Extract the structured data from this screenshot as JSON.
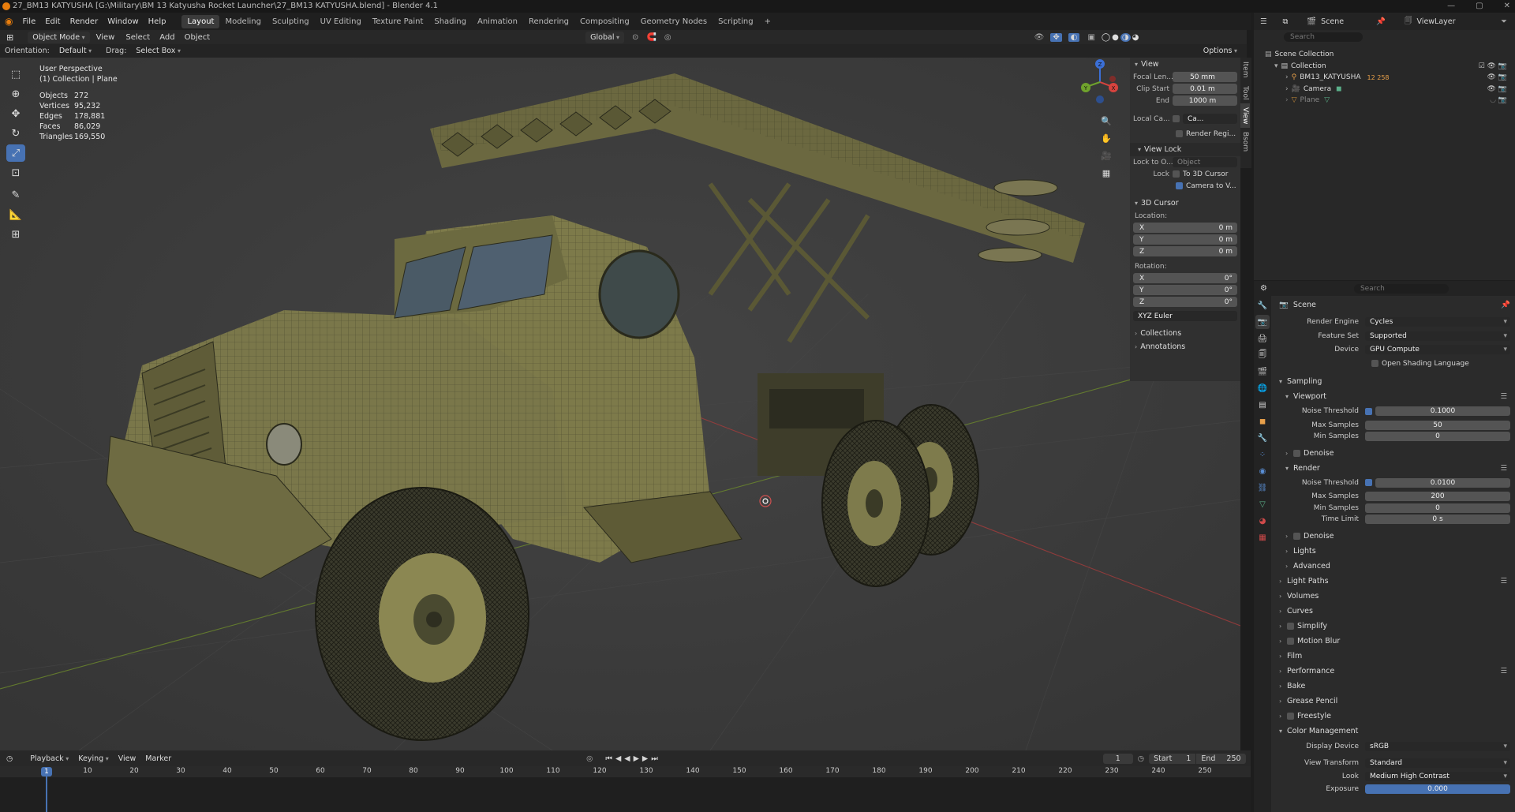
{
  "window": {
    "title": "27_BM13 KATYUSHA [G:\\Military\\BM 13 Katyusha Rocket Launcher\\27_BM13 KATYUSHA.blend] - Blender 4.1"
  },
  "menu": [
    "File",
    "Edit",
    "Render",
    "Window",
    "Help"
  ],
  "workspaces": [
    "Layout",
    "Modeling",
    "Sculpting",
    "UV Editing",
    "Texture Paint",
    "Shading",
    "Animation",
    "Rendering",
    "Compositing",
    "Geometry Nodes",
    "Scripting",
    "+"
  ],
  "header": {
    "mode": "Object Mode",
    "view": "View",
    "select": "Select",
    "add": "Add",
    "object": "Object",
    "transform": "Global"
  },
  "tool_settings": {
    "orientation_label": "Orientation:",
    "orientation": "Default",
    "drag_label": "Drag:",
    "drag": "Select Box",
    "options": "Options"
  },
  "viewport": {
    "view_name": "User Perspective",
    "collection": "(1) Collection | Plane",
    "stats": [
      [
        "Objects",
        "272"
      ],
      [
        "Vertices",
        "95,232"
      ],
      [
        "Edges",
        "178,881"
      ],
      [
        "Faces",
        "86,029"
      ],
      [
        "Triangles",
        "169,550"
      ]
    ],
    "gizmo": {
      "x": "X",
      "y": "Y",
      "z": "Z"
    }
  },
  "npanel": {
    "tabs": [
      "Item",
      "Tool",
      "View",
      "Bsom"
    ],
    "view_section": "View",
    "focal_label": "Focal Len...",
    "focal": "50 mm",
    "clip_start_label": "Clip Start",
    "clip_start": "0.01 m",
    "clip_end_label": "End",
    "clip_end": "1000 m",
    "local_cam_label": "Local Ca...",
    "local_cam": "Ca...",
    "render_region": "Render Regi...",
    "view_lock": "View Lock",
    "lock_to_label": "Lock to O...",
    "lock_to": "Object",
    "lock_label": "Lock",
    "to_cursor": "To 3D Cursor",
    "camera_to_view": "Camera to V...",
    "cursor_section": "3D Cursor",
    "location": "Location:",
    "rotation": "Rotation:",
    "loc": [
      [
        "X",
        "0 m"
      ],
      [
        "Y",
        "0 m"
      ],
      [
        "Z",
        "0 m"
      ]
    ],
    "rot": [
      [
        "X",
        "0°"
      ],
      [
        "Y",
        "0°"
      ],
      [
        "Z",
        "0°"
      ]
    ],
    "rot_mode": "XYZ Euler",
    "collections": "Collections",
    "annotations": "Annotations"
  },
  "outliner": {
    "scene": "Scene",
    "view_layer": "ViewLayer",
    "search": "Search",
    "items": [
      {
        "name": "Scene Collection",
        "indent": 0
      },
      {
        "name": "Collection",
        "indent": 1
      },
      {
        "name": "BM13_KATYUSHA",
        "indent": 2,
        "extra": "12 258"
      },
      {
        "name": "Camera",
        "indent": 2
      },
      {
        "name": "Plane",
        "indent": 2
      }
    ]
  },
  "properties": {
    "search": "Search",
    "context": "Scene",
    "render_engine_label": "Render Engine",
    "render_engine": "Cycles",
    "feature_set_label": "Feature Set",
    "feature_set": "Supported",
    "device_label": "Device",
    "device": "GPU Compute",
    "osl": "Open Shading Language",
    "sampling": "Sampling",
    "viewport": "Viewport",
    "noise_threshold": "Noise Threshold",
    "vp_noise": "0.1000",
    "max_samples": "Max Samples",
    "vp_max": "50",
    "min_samples": "Min Samples",
    "vp_min": "0",
    "denoise": "Denoise",
    "render": "Render",
    "r_noise": "0.0100",
    "r_max": "200",
    "r_min": "0",
    "time_limit": "Time Limit",
    "r_time": "0 s",
    "lights": "Lights",
    "advanced": "Advanced",
    "sections": [
      "Light Paths",
      "Volumes",
      "Curves",
      "Simplify",
      "Motion Blur",
      "Film",
      "Performance",
      "Bake",
      "Grease Pencil",
      "Freestyle",
      "Color Management"
    ],
    "display_device_label": "Display Device",
    "display_device": "sRGB",
    "view_transform_label": "View Transform",
    "view_transform": "Standard",
    "look_label": "Look",
    "look": "Medium High Contrast",
    "exposure_label": "Exposure",
    "exposure": "0.000"
  },
  "timeline": {
    "playback": "Playback",
    "keying": "Keying",
    "view": "View",
    "marker": "Marker",
    "current": "1",
    "start_label": "Start",
    "start": "1",
    "end_label": "End",
    "end": "250",
    "frame_indicator": "1",
    "ticks": [
      "10",
      "20",
      "30",
      "40",
      "50",
      "60",
      "70",
      "80",
      "90",
      "100",
      "110",
      "120",
      "130",
      "140",
      "150",
      "160",
      "170",
      "180",
      "190",
      "200",
      "210",
      "220",
      "230",
      "240",
      "250"
    ]
  }
}
